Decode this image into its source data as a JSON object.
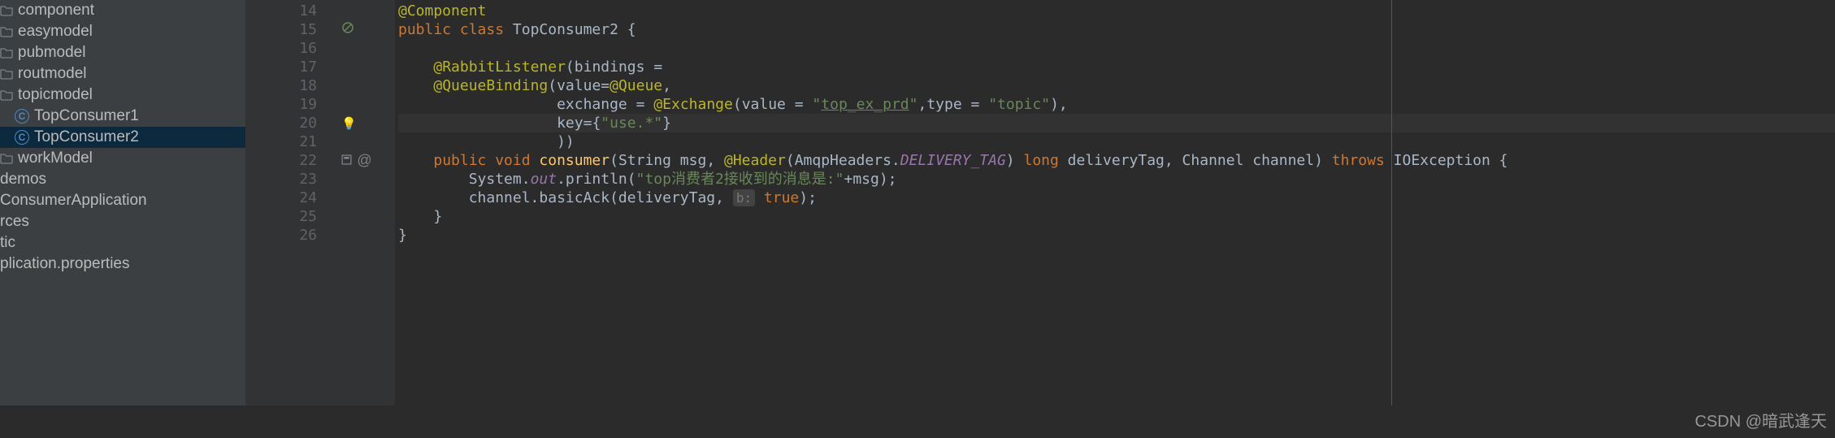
{
  "sidebar": {
    "items": [
      {
        "label": "component",
        "type": "folder",
        "indent": 0
      },
      {
        "label": "easymodel",
        "type": "folder",
        "indent": 0
      },
      {
        "label": "pubmodel",
        "type": "folder",
        "indent": 0
      },
      {
        "label": "routmodel",
        "type": "folder",
        "indent": 0
      },
      {
        "label": "topicmodel",
        "type": "folder",
        "indent": 0
      },
      {
        "label": "TopConsumer1",
        "type": "class",
        "indent": 1
      },
      {
        "label": "TopConsumer2",
        "type": "class",
        "indent": 1,
        "selected": true
      },
      {
        "label": "workModel",
        "type": "folder",
        "indent": 0
      },
      {
        "label": "demos",
        "type": "text",
        "indent": -1
      },
      {
        "label": "ConsumerApplication",
        "type": "text",
        "indent": -1
      },
      {
        "label": "rces",
        "type": "text",
        "indent": -2
      },
      {
        "label": "tic",
        "type": "text",
        "indent": -2
      },
      {
        "label": "plication.properties",
        "type": "text",
        "indent": -2
      }
    ]
  },
  "editor": {
    "startLine": 14,
    "lines": [
      {
        "n": 14,
        "tokens": [
          {
            "t": "@Component",
            "c": "ann"
          }
        ],
        "gutter": []
      },
      {
        "n": 15,
        "tokens": [
          {
            "t": "public ",
            "c": "kw"
          },
          {
            "t": "class ",
            "c": "kw"
          },
          {
            "t": "TopConsumer2 ",
            "c": "cls"
          },
          {
            "t": "{",
            "c": "white"
          }
        ],
        "gutter": [
          "noentry"
        ]
      },
      {
        "n": 16,
        "tokens": [],
        "gutter": []
      },
      {
        "n": 17,
        "tokens": [
          {
            "t": "    ",
            "c": ""
          },
          {
            "t": "@RabbitListener",
            "c": "ann"
          },
          {
            "t": "(",
            "c": "white"
          },
          {
            "t": "bindings ",
            "c": "white"
          },
          {
            "t": "=",
            "c": "white"
          }
        ],
        "gutter": []
      },
      {
        "n": 18,
        "tokens": [
          {
            "t": "    ",
            "c": ""
          },
          {
            "t": "@QueueBinding",
            "c": "ann"
          },
          {
            "t": "(",
            "c": "white"
          },
          {
            "t": "value",
            "c": "white"
          },
          {
            "t": "=",
            "c": "white"
          },
          {
            "t": "@Queue",
            "c": "ann"
          },
          {
            "t": ",",
            "c": "white"
          }
        ],
        "gutter": []
      },
      {
        "n": 19,
        "tokens": [
          {
            "t": "                  ",
            "c": ""
          },
          {
            "t": "exchange ",
            "c": "white"
          },
          {
            "t": "= ",
            "c": "white"
          },
          {
            "t": "@Exchange",
            "c": "ann"
          },
          {
            "t": "(",
            "c": "white"
          },
          {
            "t": "value ",
            "c": "white"
          },
          {
            "t": "= ",
            "c": "white"
          },
          {
            "t": "\"",
            "c": "str"
          },
          {
            "t": "top_ex_prd",
            "c": "str-u"
          },
          {
            "t": "\"",
            "c": "str"
          },
          {
            "t": ",",
            "c": "white"
          },
          {
            "t": "type ",
            "c": "white"
          },
          {
            "t": "= ",
            "c": "white"
          },
          {
            "t": "\"topic\"",
            "c": "str"
          },
          {
            "t": "),",
            "c": "white"
          }
        ],
        "gutter": []
      },
      {
        "n": 20,
        "tokens": [
          {
            "t": "                  ",
            "c": ""
          },
          {
            "t": "key",
            "c": "white"
          },
          {
            "t": "=",
            "c": "white"
          },
          {
            "t": "{",
            "c": "white"
          },
          {
            "t": "\"use.*\"",
            "c": "str"
          },
          {
            "t": "}",
            "c": "white"
          }
        ],
        "gutter": [
          "bulb"
        ],
        "caret": true
      },
      {
        "n": 21,
        "tokens": [
          {
            "t": "                  ",
            "c": ""
          },
          {
            "t": "))",
            "c": "white"
          }
        ],
        "gutter": []
      },
      {
        "n": 22,
        "tokens": [
          {
            "t": "    ",
            "c": ""
          },
          {
            "t": "public ",
            "c": "kw"
          },
          {
            "t": "void ",
            "c": "kw"
          },
          {
            "t": "consumer",
            "c": "mthd"
          },
          {
            "t": "(",
            "c": "white"
          },
          {
            "t": "String msg, ",
            "c": "white"
          },
          {
            "t": "@Header",
            "c": "ann"
          },
          {
            "t": "(",
            "c": "white"
          },
          {
            "t": "AmqpHeaders.",
            "c": "white"
          },
          {
            "t": "DELIVERY_TAG",
            "c": "static"
          },
          {
            "t": ") ",
            "c": "white"
          },
          {
            "t": "long ",
            "c": "kw"
          },
          {
            "t": "deliveryTag, Channel channel) ",
            "c": "white"
          },
          {
            "t": "throws ",
            "c": "kw"
          },
          {
            "t": "IOException {",
            "c": "white"
          }
        ],
        "gutter": [
          "run",
          "at"
        ]
      },
      {
        "n": 23,
        "tokens": [
          {
            "t": "        ",
            "c": ""
          },
          {
            "t": "System.",
            "c": "white"
          },
          {
            "t": "out",
            "c": "static"
          },
          {
            "t": ".println(",
            "c": "white"
          },
          {
            "t": "\"top消费者2接收到的消息是:\"",
            "c": "str"
          },
          {
            "t": "+msg);",
            "c": "white"
          }
        ],
        "gutter": []
      },
      {
        "n": 24,
        "tokens": [
          {
            "t": "        ",
            "c": ""
          },
          {
            "t": "channel.basicAck(deliveryTag, ",
            "c": "white"
          },
          {
            "t": "b:",
            "c": "param-hint",
            "hint": true
          },
          {
            "t": " ",
            "c": ""
          },
          {
            "t": "true",
            "c": "kw"
          },
          {
            "t": ");",
            "c": "white"
          }
        ],
        "gutter": []
      },
      {
        "n": 25,
        "tokens": [
          {
            "t": "    }",
            "c": "white"
          }
        ],
        "gutter": []
      },
      {
        "n": 26,
        "tokens": [
          {
            "t": "}",
            "c": "white"
          }
        ],
        "gutter": []
      }
    ]
  },
  "watermark": "CSDN @暗武逢天"
}
